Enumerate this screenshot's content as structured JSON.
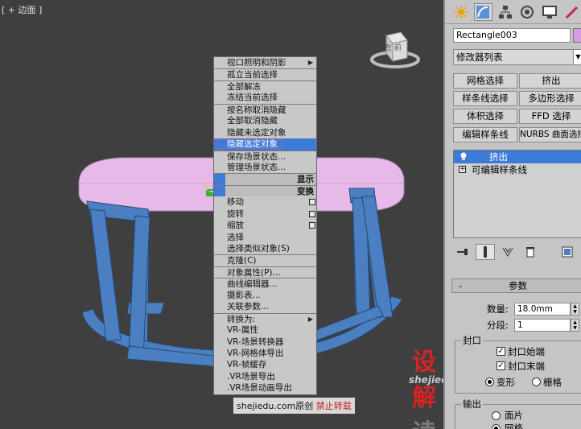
{
  "viewport": {
    "label": "[ + 边面 ]"
  },
  "viewcube": {
    "face_label": "左 前"
  },
  "quad_menu": {
    "items": [
      {
        "label": "视口照明和阴影",
        "arrow": true
      },
      {
        "label": "孤立当前选择",
        "sep": true
      },
      {
        "label": "全部解冻",
        "sep": true
      },
      {
        "label": "冻结当前选择"
      },
      {
        "label": "按名称取消隐藏",
        "sep": true
      },
      {
        "label": "全部取消隐藏"
      },
      {
        "label": "隐藏未选定对象"
      },
      {
        "label": "隐藏选定对象",
        "highlight": true
      },
      {
        "label": "保存场景状态...",
        "sep": true
      },
      {
        "label": "管理场景状态..."
      }
    ],
    "title_display": "显示",
    "title_transform": "变换",
    "transform_items": [
      {
        "label": "移动",
        "box": true
      },
      {
        "label": "旋转",
        "box": true
      },
      {
        "label": "缩放",
        "box": true
      },
      {
        "label": "选择"
      },
      {
        "label": "选择类似对象(S)"
      },
      {
        "label": "克隆(C)",
        "sep": true
      },
      {
        "label": "对象属性(P)...",
        "sep": true
      },
      {
        "label": "曲线编辑器...",
        "sep": true
      },
      {
        "label": "摄影表..."
      },
      {
        "label": "关联参数..."
      },
      {
        "label": "转换为:",
        "sep": true,
        "arrow": true
      },
      {
        "label": "VR-属性"
      },
      {
        "label": "VR-场景转换器"
      },
      {
        "label": "VR-网格体导出"
      },
      {
        "label": "VR-帧缓存"
      },
      {
        "label": ".VR场景导出"
      },
      {
        "label": ".VR场景动画导出"
      }
    ]
  },
  "watermark": {
    "logo_red": "设解",
    "logo_gray": "读",
    "url": "shejiedu.com",
    "footer_url": "shejiedu.com",
    "footer_text": "原创",
    "footer_warning": "禁止转载"
  },
  "panel": {
    "object_name": "Rectangle003",
    "object_color": "#d89be6",
    "modifier_list": "修改器列表",
    "buttons": [
      {
        "label": "网格选择"
      },
      {
        "label": "挤出"
      },
      {
        "label": "样条线选择"
      },
      {
        "label": "多边形选择"
      },
      {
        "label": "体积选择"
      },
      {
        "label": "FFD 选择"
      },
      {
        "label": "编辑样条线"
      },
      {
        "label": "NURBS 曲面选择"
      }
    ],
    "stack": [
      {
        "label": "挤出",
        "selected": true
      },
      {
        "label": "可编辑样条线",
        "selected": false
      }
    ],
    "params": {
      "rollout_title": "参数",
      "amount_label": "数量:",
      "amount_value": "18.0mm",
      "segments_label": "分段:",
      "segments_value": "1",
      "capping_title": "封口",
      "cap_start": "封口始端",
      "cap_end": "封口末端",
      "morph": "变形",
      "grid": "栅格",
      "output_title": "输出",
      "patch": "面片",
      "mesh": "网格"
    }
  }
}
